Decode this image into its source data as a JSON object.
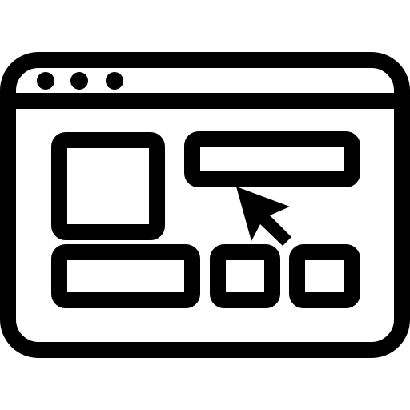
{
  "icon": {
    "name": "browser-layout-cursor-icon",
    "style": "outline",
    "stroke_color": "#000000",
    "background_color": "#ffffff"
  },
  "window": {
    "title_bar_dots": 3,
    "parts": [
      "browser-window",
      "title-bar",
      "image-block",
      "wide-bar",
      "bottom-bar",
      "small-square-left",
      "small-square-right",
      "cursor-arrow"
    ]
  }
}
